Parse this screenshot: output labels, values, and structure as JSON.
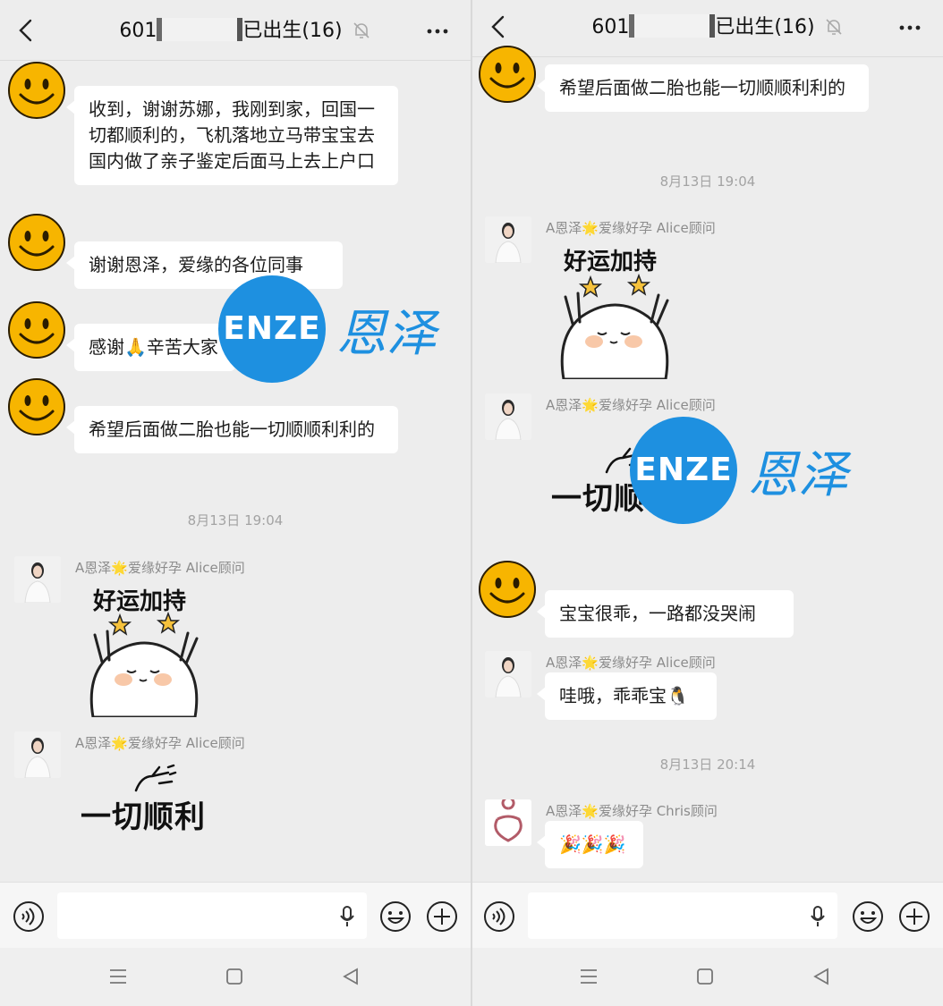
{
  "header": {
    "title_prefix": "601",
    "title_suffix": "已出生(16)"
  },
  "left": {
    "messages": [
      "收到，谢谢苏娜，我刚到家，回国一切都顺利的，飞机落地立马带宝宝去国内做了亲子鉴定后面马上去上户口",
      "谢谢恩泽，爱缘的各位同事",
      "感谢🙏辛苦大家",
      "希望后面做二胎也能一切顺顺利利的"
    ],
    "timestamp": "8月13日 19:04",
    "sender_alice": "A恩泽🌟爱缘好孕 Alice顾问",
    "sticker_goodluck": "好运加持",
    "sticker_smooth": "一切顺利"
  },
  "right": {
    "message_top": "希望后面做二胎也能一切顺顺利利的",
    "timestamp_1": "8月13日 19:04",
    "sender_alice": "A恩泽🌟爱缘好孕 Alice顾问",
    "sticker_goodluck": "好运加持",
    "sticker_smooth_partial": "一切顺",
    "message_baby": "宝宝很乖，一路都没哭闹",
    "message_wow": "哇哦，乖乖宝🐧",
    "timestamp_2": "8月13日 20:14",
    "sender_chris": "A恩泽🌟爱缘好孕 Chris顾问",
    "message_party": "🎉🎉🎉"
  },
  "watermark": {
    "latin": "ENZE",
    "chinese": "恩泽",
    "color": "#1e90e0"
  },
  "icons": [
    "back-icon",
    "mute-bell-icon",
    "more-icon",
    "voice-icon",
    "mic-icon",
    "emoji-icon",
    "plus-icon",
    "menu-nav-icon",
    "home-nav-icon",
    "back-nav-icon"
  ]
}
